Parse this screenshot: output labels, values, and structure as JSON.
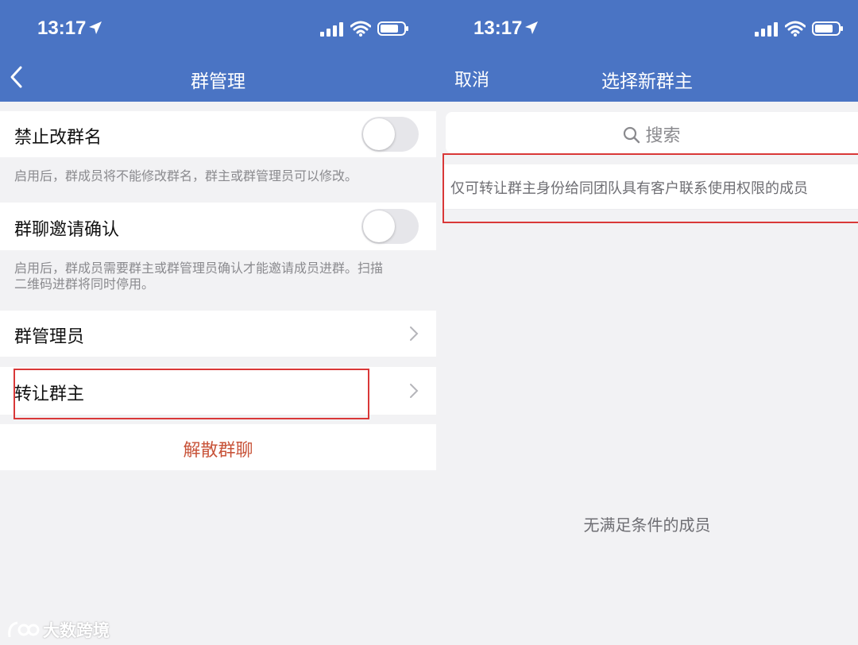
{
  "left": {
    "status": {
      "time": "13:17"
    },
    "nav": {
      "title": "群管理",
      "back_icon": "chevron-left-icon"
    },
    "rows": {
      "rename": {
        "label": "禁止改群名",
        "toggle_on": false,
        "hint": "启用后，群成员将不能修改群名，群主或群管理员可以修改。"
      },
      "invite": {
        "label": "群聊邀请确认",
        "toggle_on": false,
        "hint_line1": "启用后，群成员需要群主或群管理员确认才能邀请成员进群。扫描",
        "hint_line2": "二维码进群将同时停用。"
      },
      "admins": {
        "label": "群管理员"
      },
      "transfer": {
        "label": "转让群主"
      },
      "dissolve": {
        "label": "解散群聊"
      }
    }
  },
  "right": {
    "status": {
      "time": "13:17"
    },
    "nav": {
      "cancel": "取消",
      "title": "选择新群主"
    },
    "search": {
      "placeholder": "搜索"
    },
    "notice": "仅可转让群主身份给同团队具有客户联系使用权限的成员",
    "empty": "无满足条件的成员"
  },
  "watermark": {
    "text": "大数跨境"
  },
  "colors": {
    "header": "#4a74c4",
    "danger": "#c8543a",
    "highlight": "#d93838"
  }
}
